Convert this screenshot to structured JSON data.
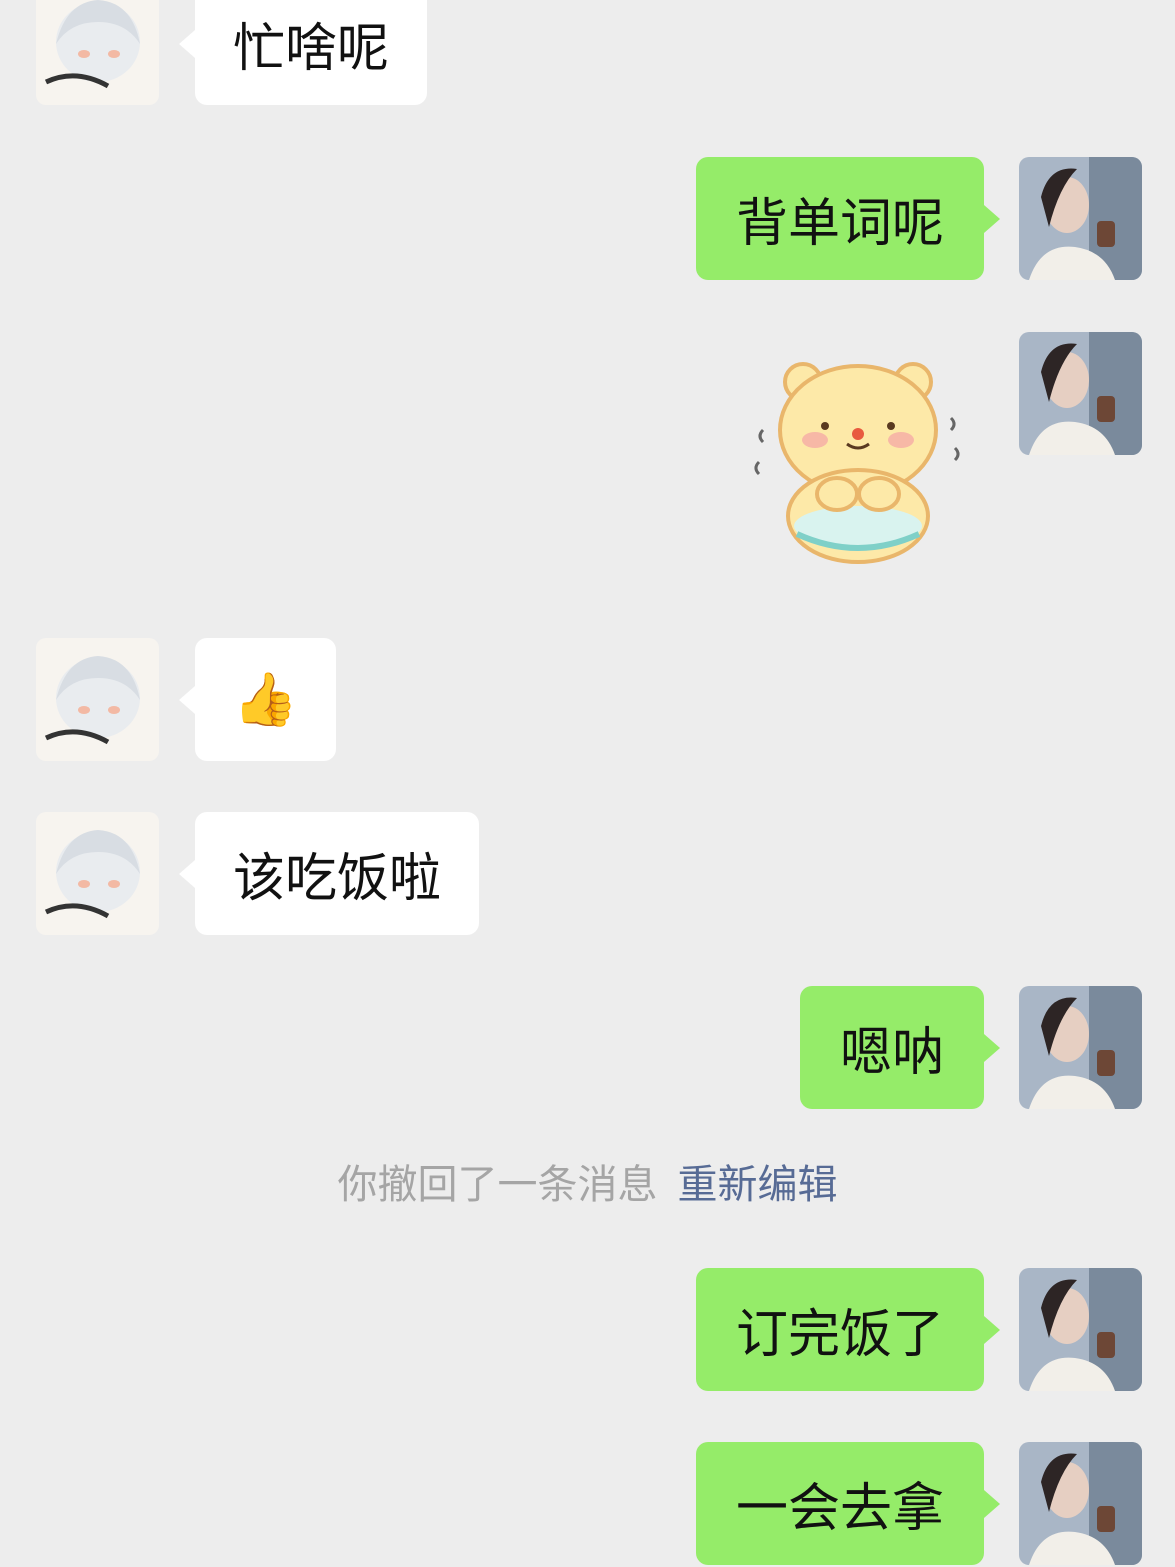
{
  "chat": {
    "messages": [
      {
        "side": "in",
        "text": "忙啥呢"
      },
      {
        "side": "out",
        "text": "背单词呢"
      },
      {
        "side": "out",
        "sticker": "bear-sticker"
      },
      {
        "side": "in",
        "emoji": "👍"
      },
      {
        "side": "in",
        "text": "该吃饭啦"
      },
      {
        "side": "out",
        "text": "嗯呐"
      },
      {
        "side": "out",
        "text": "订完饭了"
      },
      {
        "side": "out",
        "text": "一会去拿"
      }
    ],
    "system": {
      "recall_text": "你撤回了一条消息",
      "reedit_label": "重新编辑"
    }
  },
  "colors": {
    "background": "#ededed",
    "incoming_bubble": "#ffffff",
    "outgoing_bubble": "#95ec69",
    "link": "#576b95",
    "system_text": "#a5a5a5"
  }
}
